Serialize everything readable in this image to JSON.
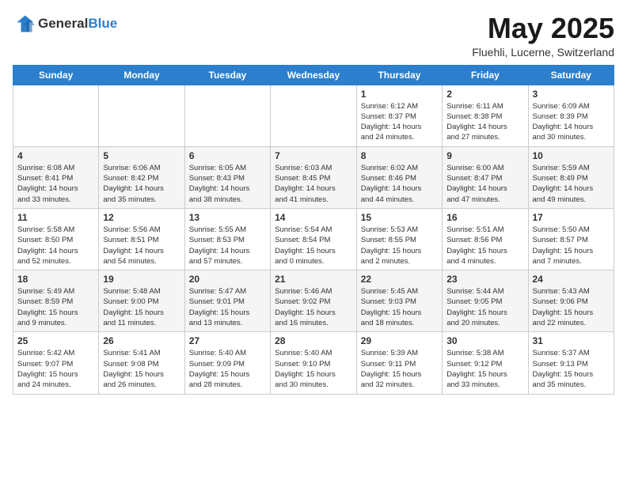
{
  "logo": {
    "general": "General",
    "blue": "Blue"
  },
  "title": "May 2025",
  "subtitle": "Fluehli, Lucerne, Switzerland",
  "weekdays": [
    "Sunday",
    "Monday",
    "Tuesday",
    "Wednesday",
    "Thursday",
    "Friday",
    "Saturday"
  ],
  "weeks": [
    [
      {
        "day": "",
        "info": ""
      },
      {
        "day": "",
        "info": ""
      },
      {
        "day": "",
        "info": ""
      },
      {
        "day": "",
        "info": ""
      },
      {
        "day": "1",
        "info": "Sunrise: 6:12 AM\nSunset: 8:37 PM\nDaylight: 14 hours\nand 24 minutes."
      },
      {
        "day": "2",
        "info": "Sunrise: 6:11 AM\nSunset: 8:38 PM\nDaylight: 14 hours\nand 27 minutes."
      },
      {
        "day": "3",
        "info": "Sunrise: 6:09 AM\nSunset: 8:39 PM\nDaylight: 14 hours\nand 30 minutes."
      }
    ],
    [
      {
        "day": "4",
        "info": "Sunrise: 6:08 AM\nSunset: 8:41 PM\nDaylight: 14 hours\nand 33 minutes."
      },
      {
        "day": "5",
        "info": "Sunrise: 6:06 AM\nSunset: 8:42 PM\nDaylight: 14 hours\nand 35 minutes."
      },
      {
        "day": "6",
        "info": "Sunrise: 6:05 AM\nSunset: 8:43 PM\nDaylight: 14 hours\nand 38 minutes."
      },
      {
        "day": "7",
        "info": "Sunrise: 6:03 AM\nSunset: 8:45 PM\nDaylight: 14 hours\nand 41 minutes."
      },
      {
        "day": "8",
        "info": "Sunrise: 6:02 AM\nSunset: 8:46 PM\nDaylight: 14 hours\nand 44 minutes."
      },
      {
        "day": "9",
        "info": "Sunrise: 6:00 AM\nSunset: 8:47 PM\nDaylight: 14 hours\nand 47 minutes."
      },
      {
        "day": "10",
        "info": "Sunrise: 5:59 AM\nSunset: 8:49 PM\nDaylight: 14 hours\nand 49 minutes."
      }
    ],
    [
      {
        "day": "11",
        "info": "Sunrise: 5:58 AM\nSunset: 8:50 PM\nDaylight: 14 hours\nand 52 minutes."
      },
      {
        "day": "12",
        "info": "Sunrise: 5:56 AM\nSunset: 8:51 PM\nDaylight: 14 hours\nand 54 minutes."
      },
      {
        "day": "13",
        "info": "Sunrise: 5:55 AM\nSunset: 8:53 PM\nDaylight: 14 hours\nand 57 minutes."
      },
      {
        "day": "14",
        "info": "Sunrise: 5:54 AM\nSunset: 8:54 PM\nDaylight: 15 hours\nand 0 minutes."
      },
      {
        "day": "15",
        "info": "Sunrise: 5:53 AM\nSunset: 8:55 PM\nDaylight: 15 hours\nand 2 minutes."
      },
      {
        "day": "16",
        "info": "Sunrise: 5:51 AM\nSunset: 8:56 PM\nDaylight: 15 hours\nand 4 minutes."
      },
      {
        "day": "17",
        "info": "Sunrise: 5:50 AM\nSunset: 8:57 PM\nDaylight: 15 hours\nand 7 minutes."
      }
    ],
    [
      {
        "day": "18",
        "info": "Sunrise: 5:49 AM\nSunset: 8:59 PM\nDaylight: 15 hours\nand 9 minutes."
      },
      {
        "day": "19",
        "info": "Sunrise: 5:48 AM\nSunset: 9:00 PM\nDaylight: 15 hours\nand 11 minutes."
      },
      {
        "day": "20",
        "info": "Sunrise: 5:47 AM\nSunset: 9:01 PM\nDaylight: 15 hours\nand 13 minutes."
      },
      {
        "day": "21",
        "info": "Sunrise: 5:46 AM\nSunset: 9:02 PM\nDaylight: 15 hours\nand 16 minutes."
      },
      {
        "day": "22",
        "info": "Sunrise: 5:45 AM\nSunset: 9:03 PM\nDaylight: 15 hours\nand 18 minutes."
      },
      {
        "day": "23",
        "info": "Sunrise: 5:44 AM\nSunset: 9:05 PM\nDaylight: 15 hours\nand 20 minutes."
      },
      {
        "day": "24",
        "info": "Sunrise: 5:43 AM\nSunset: 9:06 PM\nDaylight: 15 hours\nand 22 minutes."
      }
    ],
    [
      {
        "day": "25",
        "info": "Sunrise: 5:42 AM\nSunset: 9:07 PM\nDaylight: 15 hours\nand 24 minutes."
      },
      {
        "day": "26",
        "info": "Sunrise: 5:41 AM\nSunset: 9:08 PM\nDaylight: 15 hours\nand 26 minutes."
      },
      {
        "day": "27",
        "info": "Sunrise: 5:40 AM\nSunset: 9:09 PM\nDaylight: 15 hours\nand 28 minutes."
      },
      {
        "day": "28",
        "info": "Sunrise: 5:40 AM\nSunset: 9:10 PM\nDaylight: 15 hours\nand 30 minutes."
      },
      {
        "day": "29",
        "info": "Sunrise: 5:39 AM\nSunset: 9:11 PM\nDaylight: 15 hours\nand 32 minutes."
      },
      {
        "day": "30",
        "info": "Sunrise: 5:38 AM\nSunset: 9:12 PM\nDaylight: 15 hours\nand 33 minutes."
      },
      {
        "day": "31",
        "info": "Sunrise: 5:37 AM\nSunset: 9:13 PM\nDaylight: 15 hours\nand 35 minutes."
      }
    ]
  ]
}
